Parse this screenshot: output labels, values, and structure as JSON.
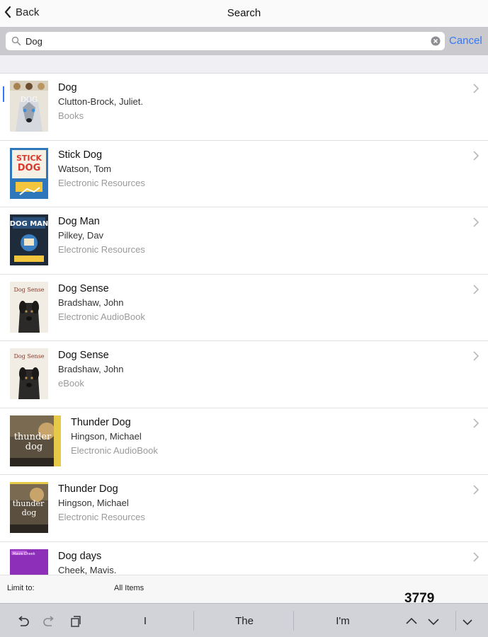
{
  "nav": {
    "back_label": "Back",
    "title": "Search"
  },
  "search": {
    "query": "Dog",
    "cancel_label": "Cancel"
  },
  "results": [
    {
      "title": "Dog",
      "author": "Clutton-Brock, Juliet.",
      "type": "Books",
      "cover": "Husky dog cover"
    },
    {
      "title": "Stick Dog",
      "author": "Watson, Tom",
      "type": "Electronic Resources",
      "cover": "STICK DOG"
    },
    {
      "title": "Dog Man",
      "author": "Pilkey, Dav",
      "type": "Electronic Resources",
      "cover": "DOG MAN"
    },
    {
      "title": "Dog Sense",
      "author": "Bradshaw, John",
      "type": "Electronic AudioBook",
      "cover": "Dog Sense"
    },
    {
      "title": "Dog Sense",
      "author": "Bradshaw, John",
      "type": "eBook",
      "cover": "Dog Sense"
    },
    {
      "title": "Thunder Dog",
      "author": "Hingson, Michael",
      "type": "Electronic AudioBook",
      "cover": "thunder dog"
    },
    {
      "title": "Thunder Dog",
      "author": "Hingson, Michael",
      "type": "Electronic Resources",
      "cover": "thunder dog"
    },
    {
      "title": "Dog days",
      "author": "Cheek, Mavis.",
      "type": "",
      "cover": "Mavis Cheek"
    }
  ],
  "footer": {
    "limit_label": "Limit to:",
    "limit_value": "All Items",
    "count": "3779"
  },
  "keyboard": {
    "suggestions": [
      "I",
      "The",
      "I'm"
    ]
  },
  "colors": {
    "accent": "#3478f6",
    "search_bar_bg": "#c9c9ce",
    "keyboard_bg": "#d1d3d9"
  }
}
